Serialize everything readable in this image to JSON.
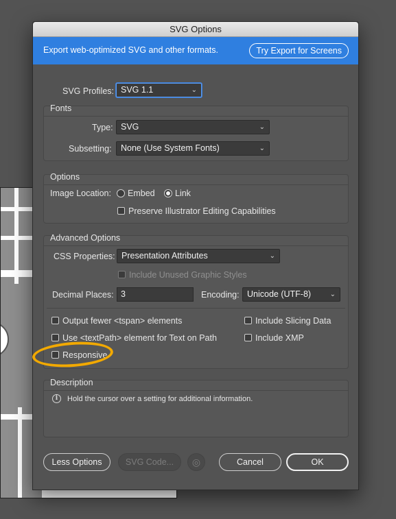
{
  "dialog": {
    "title": "SVG Options"
  },
  "banner": {
    "text": "Export web-optimized SVG and other formats.",
    "button": "Try Export for Screens"
  },
  "profiles": {
    "label": "SVG Profiles:",
    "value": "SVG 1.1"
  },
  "fonts": {
    "title": "Fonts",
    "type_label": "Type:",
    "type_value": "SVG",
    "subsetting_label": "Subsetting:",
    "subsetting_value": "None (Use System Fonts)"
  },
  "options": {
    "title": "Options",
    "image_location_label": "Image Location:",
    "embed_label": "Embed",
    "embed_selected": false,
    "link_label": "Link",
    "link_selected": true,
    "preserve_label": "Preserve Illustrator Editing Capabilities",
    "preserve_checked": false
  },
  "advanced": {
    "title": "Advanced Options",
    "css_label": "CSS Properties:",
    "css_value": "Presentation Attributes",
    "unused_label": "Include Unused Graphic Styles",
    "decimal_label": "Decimal Places:",
    "decimal_value": "3",
    "encoding_label": "Encoding:",
    "encoding_value": "Unicode (UTF-8)",
    "tspan_label": "Output fewer <tspan> elements",
    "textpath_label": "Use <textPath> element for Text on Path",
    "responsive_label": "Responsive",
    "slicing_label": "Include Slicing Data",
    "xmp_label": "Include XMP"
  },
  "description": {
    "title": "Description",
    "text": "Hold the cursor over a setting for additional information."
  },
  "buttons": {
    "less_options": "Less Options",
    "svg_code": "SVG Code...",
    "cancel": "Cancel",
    "ok": "OK"
  },
  "icons": {
    "info": "info-icon",
    "globe": "globe-icon",
    "chevron": "chevron-down-icon"
  },
  "colors": {
    "banner": "#2f7fe0",
    "highlight": "#f2a900"
  }
}
